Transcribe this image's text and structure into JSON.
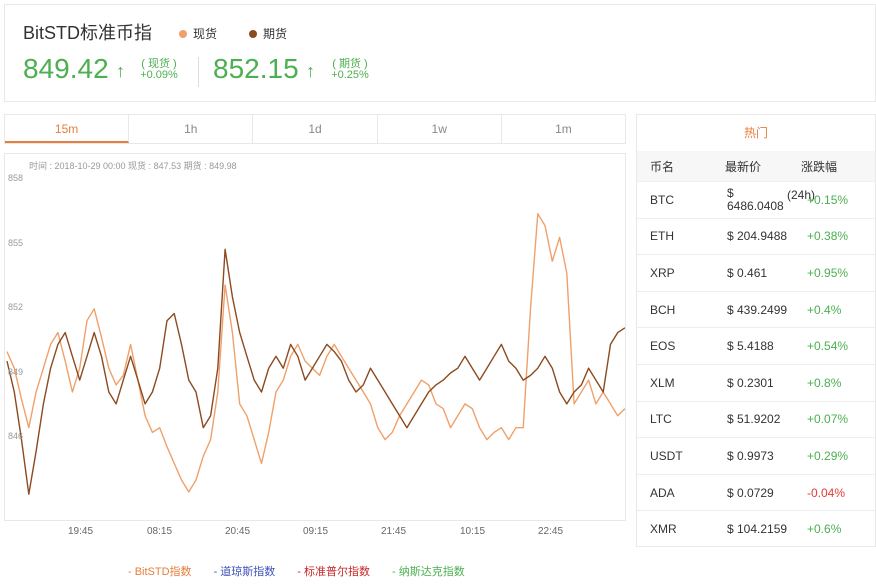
{
  "header": {
    "title": "BitSTD标准币指",
    "legend": [
      {
        "label": "现货",
        "color": "#f0a06a"
      },
      {
        "label": "期货",
        "color": "#8b4a1f"
      }
    ],
    "spot": {
      "price": "849.42",
      "arrow": "↑",
      "label": "( 现货 )",
      "change": "+0.09%"
    },
    "futures": {
      "price": "852.15",
      "arrow": "↑",
      "label": "( 期货 )",
      "change": "+0.25%"
    }
  },
  "tabs": [
    "15m",
    "1h",
    "1d",
    "1w",
    "1m"
  ],
  "active_tab": "15m",
  "chart_info": "时间 : 2018-10-29 00:00   现货 : 847.53   期货 : 849.98",
  "bottom_legend": [
    {
      "label": "-  BitSTD指数",
      "color": "#e87e3b"
    },
    {
      "label": "-  道琼斯指数",
      "color": "#3f51b5"
    },
    {
      "label": "-  标准普尔指数",
      "color": "#c62828"
    },
    {
      "label": "-  纳斯达克指数",
      "color": "#4caf50"
    }
  ],
  "hot": {
    "title": "热门",
    "columns": [
      "币名",
      "最新价",
      "涨跌幅"
    ],
    "rows": [
      {
        "name": "BTC",
        "price": "$ 6486.0408",
        "extra": "(24h)",
        "change": "+0.15%",
        "dir": "up"
      },
      {
        "name": "ETH",
        "price": "$ 204.9488",
        "change": "+0.38%",
        "dir": "up"
      },
      {
        "name": "XRP",
        "price": "$ 0.461",
        "change": "+0.95%",
        "dir": "up"
      },
      {
        "name": "BCH",
        "price": "$ 439.2499",
        "change": "+0.4%",
        "dir": "up"
      },
      {
        "name": "EOS",
        "price": "$ 5.4188",
        "change": "+0.54%",
        "dir": "up"
      },
      {
        "name": "XLM",
        "price": "$ 0.2301",
        "change": "+0.8%",
        "dir": "up"
      },
      {
        "name": "LTC",
        "price": "$ 51.9202",
        "change": "+0.07%",
        "dir": "up"
      },
      {
        "name": "USDT",
        "price": "$ 0.9973",
        "change": "+0.29%",
        "dir": "up"
      },
      {
        "name": "ADA",
        "price": "$ 0.0729",
        "change": "-0.04%",
        "dir": "down"
      },
      {
        "name": "XMR",
        "price": "$ 104.2159",
        "change": "+0.6%",
        "dir": "up"
      }
    ]
  },
  "chart_data": {
    "type": "line",
    "x_ticks": [
      "19:45",
      "08:15",
      "20:45",
      "09:15",
      "21:45",
      "10:15",
      "22:45"
    ],
    "y_ticks": [
      "858",
      "855",
      "852",
      "849",
      "846"
    ],
    "ylim": [
      845,
      858.5
    ],
    "grid": false,
    "series": [
      {
        "name": "现货",
        "color": "#f0a06a",
        "values": [
          851.2,
          850.5,
          849.2,
          848.0,
          849.5,
          850.5,
          851.5,
          852.0,
          850.8,
          849.5,
          850.5,
          852.5,
          853.0,
          851.8,
          850.5,
          849.8,
          850.2,
          851.5,
          850.0,
          848.5,
          847.8,
          848.0,
          847.2,
          846.5,
          845.8,
          845.3,
          845.8,
          846.8,
          847.5,
          849.5,
          854.0,
          852.0,
          849.0,
          848.5,
          847.5,
          846.5,
          847.8,
          849.5,
          850.0,
          851.0,
          851.5,
          850.8,
          850.5,
          850.2,
          851.0,
          851.5,
          851.0,
          850.5,
          850.0,
          849.5,
          849.0,
          848.0,
          847.5,
          847.8,
          848.5,
          849.0,
          849.5,
          850.0,
          849.8,
          849.0,
          848.8,
          848.0,
          848.5,
          849.0,
          848.8,
          848.0,
          847.5,
          847.8,
          848.0,
          847.5,
          848.0,
          848.0,
          853.0,
          857.0,
          856.5,
          855.0,
          856.0,
          854.5,
          849.0,
          849.5,
          850.0,
          849.0,
          849.5,
          849.0,
          848.5,
          848.8
        ]
      },
      {
        "name": "期货",
        "color": "#8b4a1f",
        "values": [
          850.8,
          849.5,
          847.5,
          845.2,
          847.0,
          849.0,
          850.5,
          851.5,
          852.0,
          851.0,
          850.0,
          851.0,
          852.0,
          851.0,
          849.5,
          849.0,
          850.0,
          851.0,
          850.0,
          849.0,
          849.5,
          850.5,
          852.5,
          852.8,
          851.5,
          850.0,
          849.5,
          848.0,
          848.5,
          850.5,
          855.5,
          853.5,
          852.0,
          851.0,
          850.0,
          849.5,
          850.5,
          851.0,
          850.5,
          851.5,
          851.0,
          850.0,
          850.5,
          851.0,
          851.5,
          851.2,
          850.8,
          850.0,
          849.5,
          849.8,
          850.5,
          850.0,
          849.5,
          849.0,
          848.5,
          848.0,
          848.5,
          849.0,
          849.5,
          849.8,
          850.0,
          850.3,
          850.5,
          851.0,
          850.5,
          850.0,
          850.5,
          851.0,
          851.5,
          850.8,
          850.5,
          850.0,
          850.2,
          850.5,
          851.0,
          850.5,
          849.5,
          849.0,
          849.5,
          849.8,
          850.5,
          850.0,
          849.5,
          851.5,
          852.0,
          852.2
        ]
      }
    ]
  }
}
